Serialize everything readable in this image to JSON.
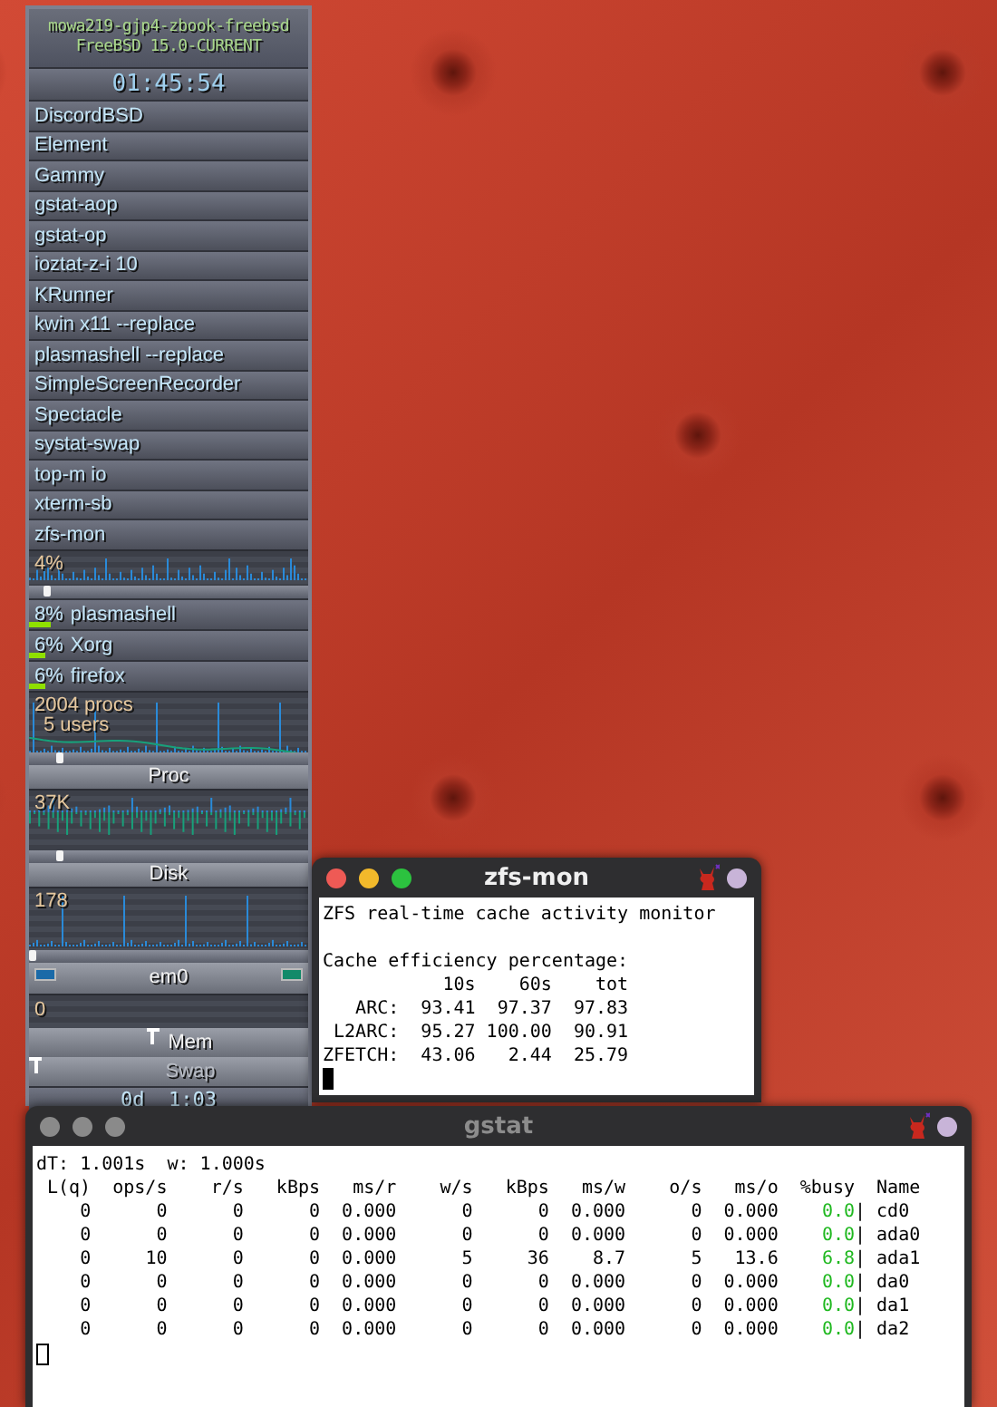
{
  "panel": {
    "hostname": "mowa219-gjp4-zbook-freebsd",
    "os": "FreeBSD 15.0-CURRENT",
    "clock": "01:45:54",
    "launchers": [
      "DiscordBSD",
      "Element",
      "Gammy",
      "gstat-aop",
      "gstat-op",
      "ioztat-z-i 10",
      "KRunner",
      "kwin x11 --replace",
      "plasmashell --replace",
      "SimpleScreenRecorder",
      "Spectacle",
      "systat-swap",
      "top-m io",
      "xterm-sb",
      "zfs-mon"
    ],
    "cpu": {
      "reading": "4%",
      "level": 0.05
    },
    "top_processes": [
      {
        "percent": "8%",
        "name": "plasmashell",
        "level": 0.08
      },
      {
        "percent": "6%",
        "name": "Xorg",
        "level": 0.06
      },
      {
        "percent": "6%",
        "name": "firefox",
        "level": 0.06
      }
    ],
    "proc": {
      "readings": [
        "2004 procs",
        "5 users"
      ],
      "level": 0.1,
      "label": "Proc"
    },
    "disk": {
      "reading": "37K",
      "level": 0.1,
      "label": "Disk"
    },
    "net": {
      "reading": "178",
      "level": 0.0,
      "label": "em0"
    },
    "meter": {
      "reading": "0"
    },
    "mem": {
      "label": "Mem",
      "level": 0.44
    },
    "swap": {
      "label": "Swap",
      "level": 0.0
    },
    "uptime": "0d  1:03"
  },
  "zfs_mon_window": {
    "title": "zfs-mon",
    "active": true,
    "intro": "ZFS real-time cache activity monitor",
    "subtitle": "Cache efficiency percentage:",
    "columns": [
      "10s",
      "60s",
      "tot"
    ],
    "rows": [
      {
        "label": "ARC:",
        "values": [
          "93.41",
          "97.37",
          "97.83"
        ]
      },
      {
        "label": "L2ARC:",
        "values": [
          "95.27",
          "100.00",
          "90.91"
        ]
      },
      {
        "label": "ZFETCH:",
        "values": [
          "43.06",
          "2.44",
          "25.79"
        ]
      }
    ]
  },
  "gstat_window": {
    "title": "gstat",
    "active": false,
    "summary": "dT: 1.001s  w: 1.000s",
    "columns": [
      "L(q)",
      "ops/s",
      "r/s",
      "kBps",
      "ms/r",
      "w/s",
      "kBps",
      "ms/w",
      "o/s",
      "ms/o",
      "%busy",
      "Name"
    ],
    "rows": [
      {
        "cells": [
          "0",
          "0",
          "0",
          "0",
          "0.000",
          "0",
          "0",
          "0.000",
          "0",
          "0.000"
        ],
        "busy": "0.0",
        "bar": "|",
        "name": "cd0"
      },
      {
        "cells": [
          "0",
          "0",
          "0",
          "0",
          "0.000",
          "0",
          "0",
          "0.000",
          "0",
          "0.000"
        ],
        "busy": "0.0",
        "bar": "|",
        "name": "ada0"
      },
      {
        "cells": [
          "0",
          "10",
          "0",
          "0",
          "0.000",
          "5",
          "36",
          "8.7",
          "5",
          "13.6"
        ],
        "busy": "6.8",
        "bar": "|",
        "name": "ada1"
      },
      {
        "cells": [
          "0",
          "0",
          "0",
          "0",
          "0.000",
          "0",
          "0",
          "0.000",
          "0",
          "0.000"
        ],
        "busy": "0.0",
        "bar": "|",
        "name": "da0"
      },
      {
        "cells": [
          "0",
          "0",
          "0",
          "0",
          "0.000",
          "0",
          "0",
          "0.000",
          "0",
          "0.000"
        ],
        "busy": "0.0",
        "bar": "|",
        "name": "da1"
      },
      {
        "cells": [
          "0",
          "0",
          "0",
          "0",
          "0.000",
          "0",
          "0",
          "0.000",
          "0",
          "0.000"
        ],
        "busy": "0.0",
        "bar": "|",
        "name": "da2"
      }
    ]
  }
}
